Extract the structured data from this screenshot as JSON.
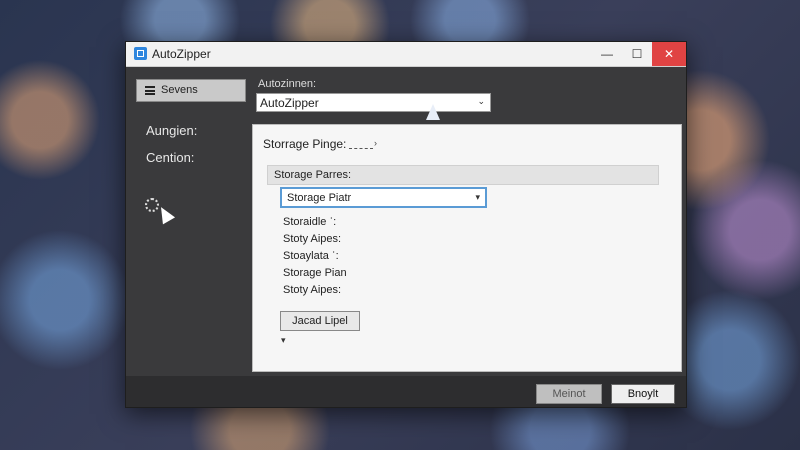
{
  "window": {
    "title": "AutoZipper",
    "min_glyph": "—",
    "max_glyph": "☐",
    "close_glyph": "✕"
  },
  "sidebar": {
    "button_label": "Sevens",
    "items": [
      {
        "label": "Aungien:"
      },
      {
        "label": "Cention:"
      }
    ]
  },
  "top": {
    "label": "Autozinnen:",
    "select_value": "AutoZipper",
    "caret": "⌄"
  },
  "panel": {
    "title": "Storrage Pinge:",
    "title_arrow": "›",
    "group_header": "Storage Parres:",
    "select_value": "Storage Piatr",
    "select_caret": "▾",
    "items": [
      {
        "label": "Storaidle ʾ:"
      },
      {
        "label": "Stoty Aipes:"
      },
      {
        "label": "Stoaylata ʾ:"
      },
      {
        "label": "Storage Pian"
      },
      {
        "label": "Stoty Aipes:"
      }
    ],
    "action_button": "Jacad Lipel",
    "small_mark": "▾"
  },
  "footer": {
    "manual_button": "Meinot",
    "install_button": "Bnoylt"
  },
  "colors": {
    "accent": "#2e86de",
    "close": "#e04343",
    "window_bg": "#3a3a3c"
  }
}
